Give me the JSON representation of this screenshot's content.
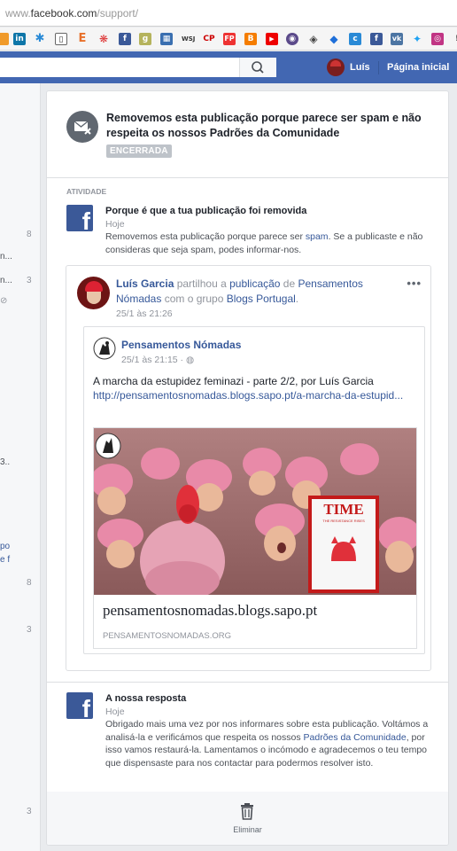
{
  "browser": {
    "url_prefix": "www.",
    "url_domain": "facebook.com",
    "url_path": "/support/"
  },
  "topbar": {
    "user_name": "Luís",
    "home_label": "Página inicial"
  },
  "left_column": {
    "items": [
      "8",
      "n...",
      "n...",
      "3",
      "3..",
      "8",
      "3",
      "3"
    ]
  },
  "report": {
    "title": "Removemos esta publicação porque parece ser spam e não respeita os nossos Padrões da Comunidade",
    "status": "ENCERRADA",
    "activity_label": "ATIVIDADE",
    "event1": {
      "title": "Porque é que a tua publicação foi removida",
      "time": "Hoje",
      "text_before": "Removemos esta publicação porque parece ser ",
      "link": "spam",
      "text_after": ". Se a publicaste e não consideras que seja spam, podes informar-nos."
    },
    "event2": {
      "title": "A nossa resposta",
      "time": "Hoje",
      "text_before": "Obrigado mais uma vez por nos informares sobre esta publicação. Voltámos a analisá-la e verificámos que respeita os nossos ",
      "link": "Padrões da Comunidade",
      "text_after": ", por isso vamos restaurá-la. Lamentamos o incómodo e agradecemos o teu tempo que dispensaste para nos contactar para podermos resolver isto."
    },
    "delete_label": "Eliminar"
  },
  "post": {
    "author": "Luís Garcia",
    "shared_word": " partilhou a ",
    "publication_link": "publicação",
    "of_word": " de ",
    "page_link": "Pensamentos Nómadas",
    "group_word": " com o grupo ",
    "group_link": "Blogs Portugal",
    "period": ".",
    "time": "25/1 às 21:26",
    "menu": "•••",
    "shared": {
      "page": "Pensamentos Nómadas",
      "time": "25/1 às 21:15 · ",
      "text": "A marcha da estupidez feminazi - parte 2/2, por Luís Garcia",
      "url": "http://pensamentosnomadas.blogs.sapo.pt/a-marcha-da-estupid...",
      "card_title": "pensamentosnomadas.blogs.sapo.pt",
      "card_domain": "PENSAMENTOSNOMADAS.ORG",
      "magazine": "TIME",
      "magazine_cover_line": "THE RESISTANCE RISES"
    }
  },
  "colors": {
    "facebook_blue": "#4267b2",
    "link_blue": "#365899",
    "hat_pink": "#e88aa8"
  }
}
